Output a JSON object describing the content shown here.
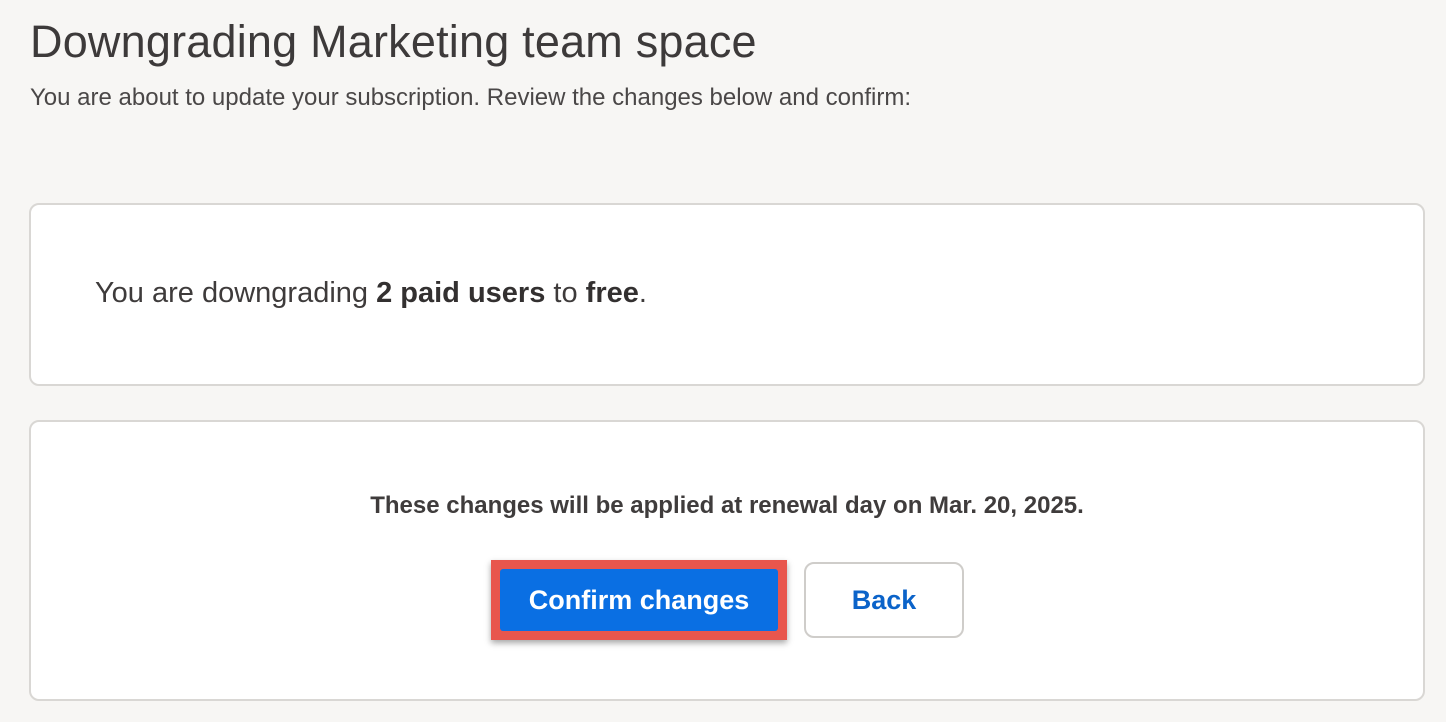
{
  "header": {
    "title": "Downgrading Marketing team space",
    "subtitle": "You are about to update your subscription. Review the changes below and confirm:"
  },
  "summary": {
    "prefix": "You are downgrading ",
    "users": "2 paid users",
    "middle": " to ",
    "plan": "free",
    "suffix": "."
  },
  "actions": {
    "renewal_notice": "These changes will be applied at renewal day on Mar. 20, 2025.",
    "confirm_label": "Confirm changes",
    "back_label": "Back"
  },
  "colors": {
    "primary_button": "#0a6fe3",
    "highlight_border": "#e8564d",
    "link_text": "#0b63c9",
    "page_background": "#f7f6f4"
  }
}
